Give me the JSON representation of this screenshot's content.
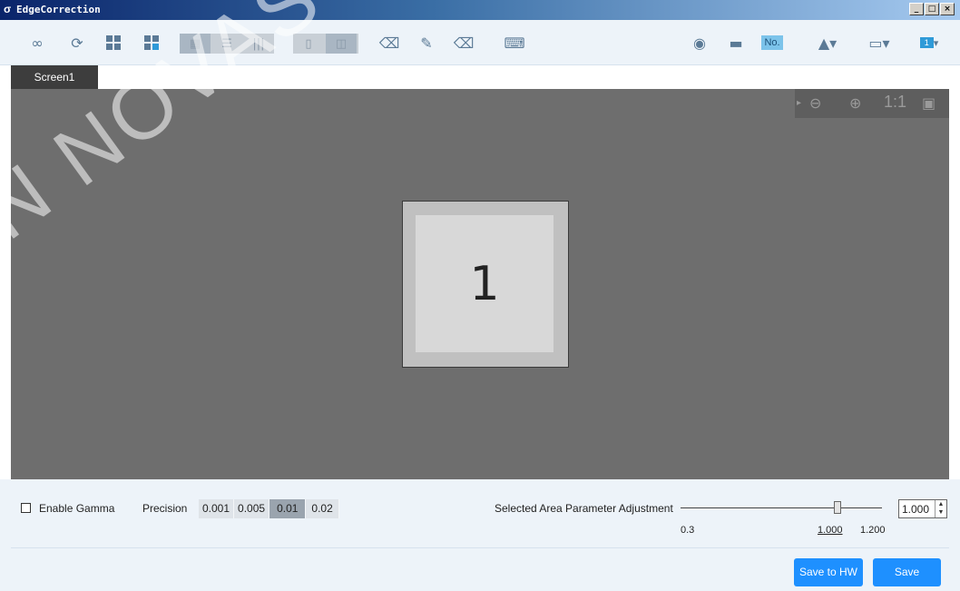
{
  "window": {
    "title": "EdgeCorrection",
    "app_icon": "σ",
    "min": "_",
    "max": "□",
    "close": "×"
  },
  "toolbar": {
    "icons": [
      "link-icon",
      "refresh-icon",
      "grid-full-icon",
      "grid-quarter-icon",
      "layout-a-icon",
      "layout-rows-icon",
      "layout-cols-icon",
      "frame-outline-icon",
      "frame-cols-icon",
      "eraser-icon",
      "brush-icon",
      "eraser-alt-icon",
      "keyboard-icon",
      "eye-icon",
      "minus-icon",
      "no-toggle-icon",
      "camera-dropdown-icon",
      "screen-dropdown-icon",
      "number-dropdown-icon"
    ],
    "no_label": "No.",
    "number_label": "1"
  },
  "tabs": [
    {
      "label": "Screen1"
    }
  ],
  "zoom": {
    "one_to_one": "1:1"
  },
  "screen": {
    "number": "1"
  },
  "watermark": "N NOVASTAR TE",
  "bottom": {
    "enable_gamma": "Enable Gamma",
    "precision_label": "Precision",
    "precision_options": [
      "0.001",
      "0.005",
      "0.01",
      "0.02"
    ],
    "precision_selected": "0.01",
    "param_label": "Selected Area Parameter Adjustment",
    "slider_min": "0.3",
    "slider_current": "1.000",
    "slider_max": "1.200",
    "slider_value": 1.0,
    "spin_value": "1.000",
    "save_hw": "Save to HW",
    "save": "Save"
  },
  "colors": {
    "accent": "#1e90ff",
    "canvas": "#6e6e6e",
    "titlebar": "#0a246a"
  }
}
